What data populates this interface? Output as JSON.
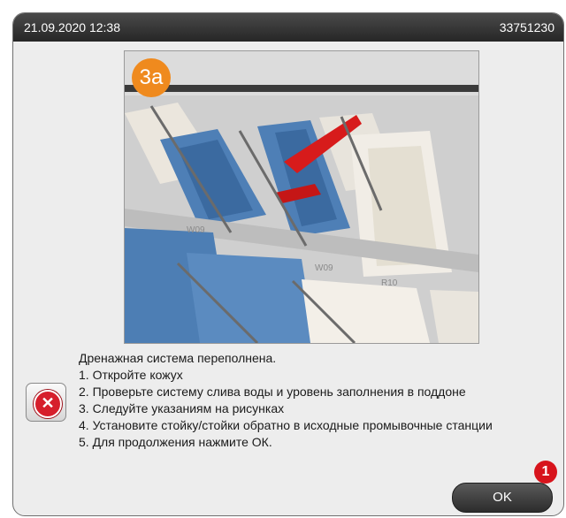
{
  "titlebar": {
    "datetime": "21.09.2020 12:38",
    "serial": "33751230"
  },
  "image": {
    "step_badge": "3a",
    "labels": [
      "W09",
      "W09",
      "R10"
    ]
  },
  "message": {
    "lines": [
      "Дренажная система переполнена.",
      "1. Откройте кожух",
      "2. Проверьте систему слива воды и уровень заполнения в поддоне",
      "3. Следуйте указаниям на рисунках",
      "4. Установите стойку/стойки обратно в исходные промывочные станции",
      "5. Для продолжения нажмите ОК."
    ]
  },
  "buttons": {
    "ok_label": "OK"
  },
  "callout": {
    "number": "1"
  },
  "colors": {
    "accent_orange": "#ef8a1e",
    "error_red": "#d61f2c",
    "callout_red": "#d7141c",
    "titlebar": "#262626"
  }
}
